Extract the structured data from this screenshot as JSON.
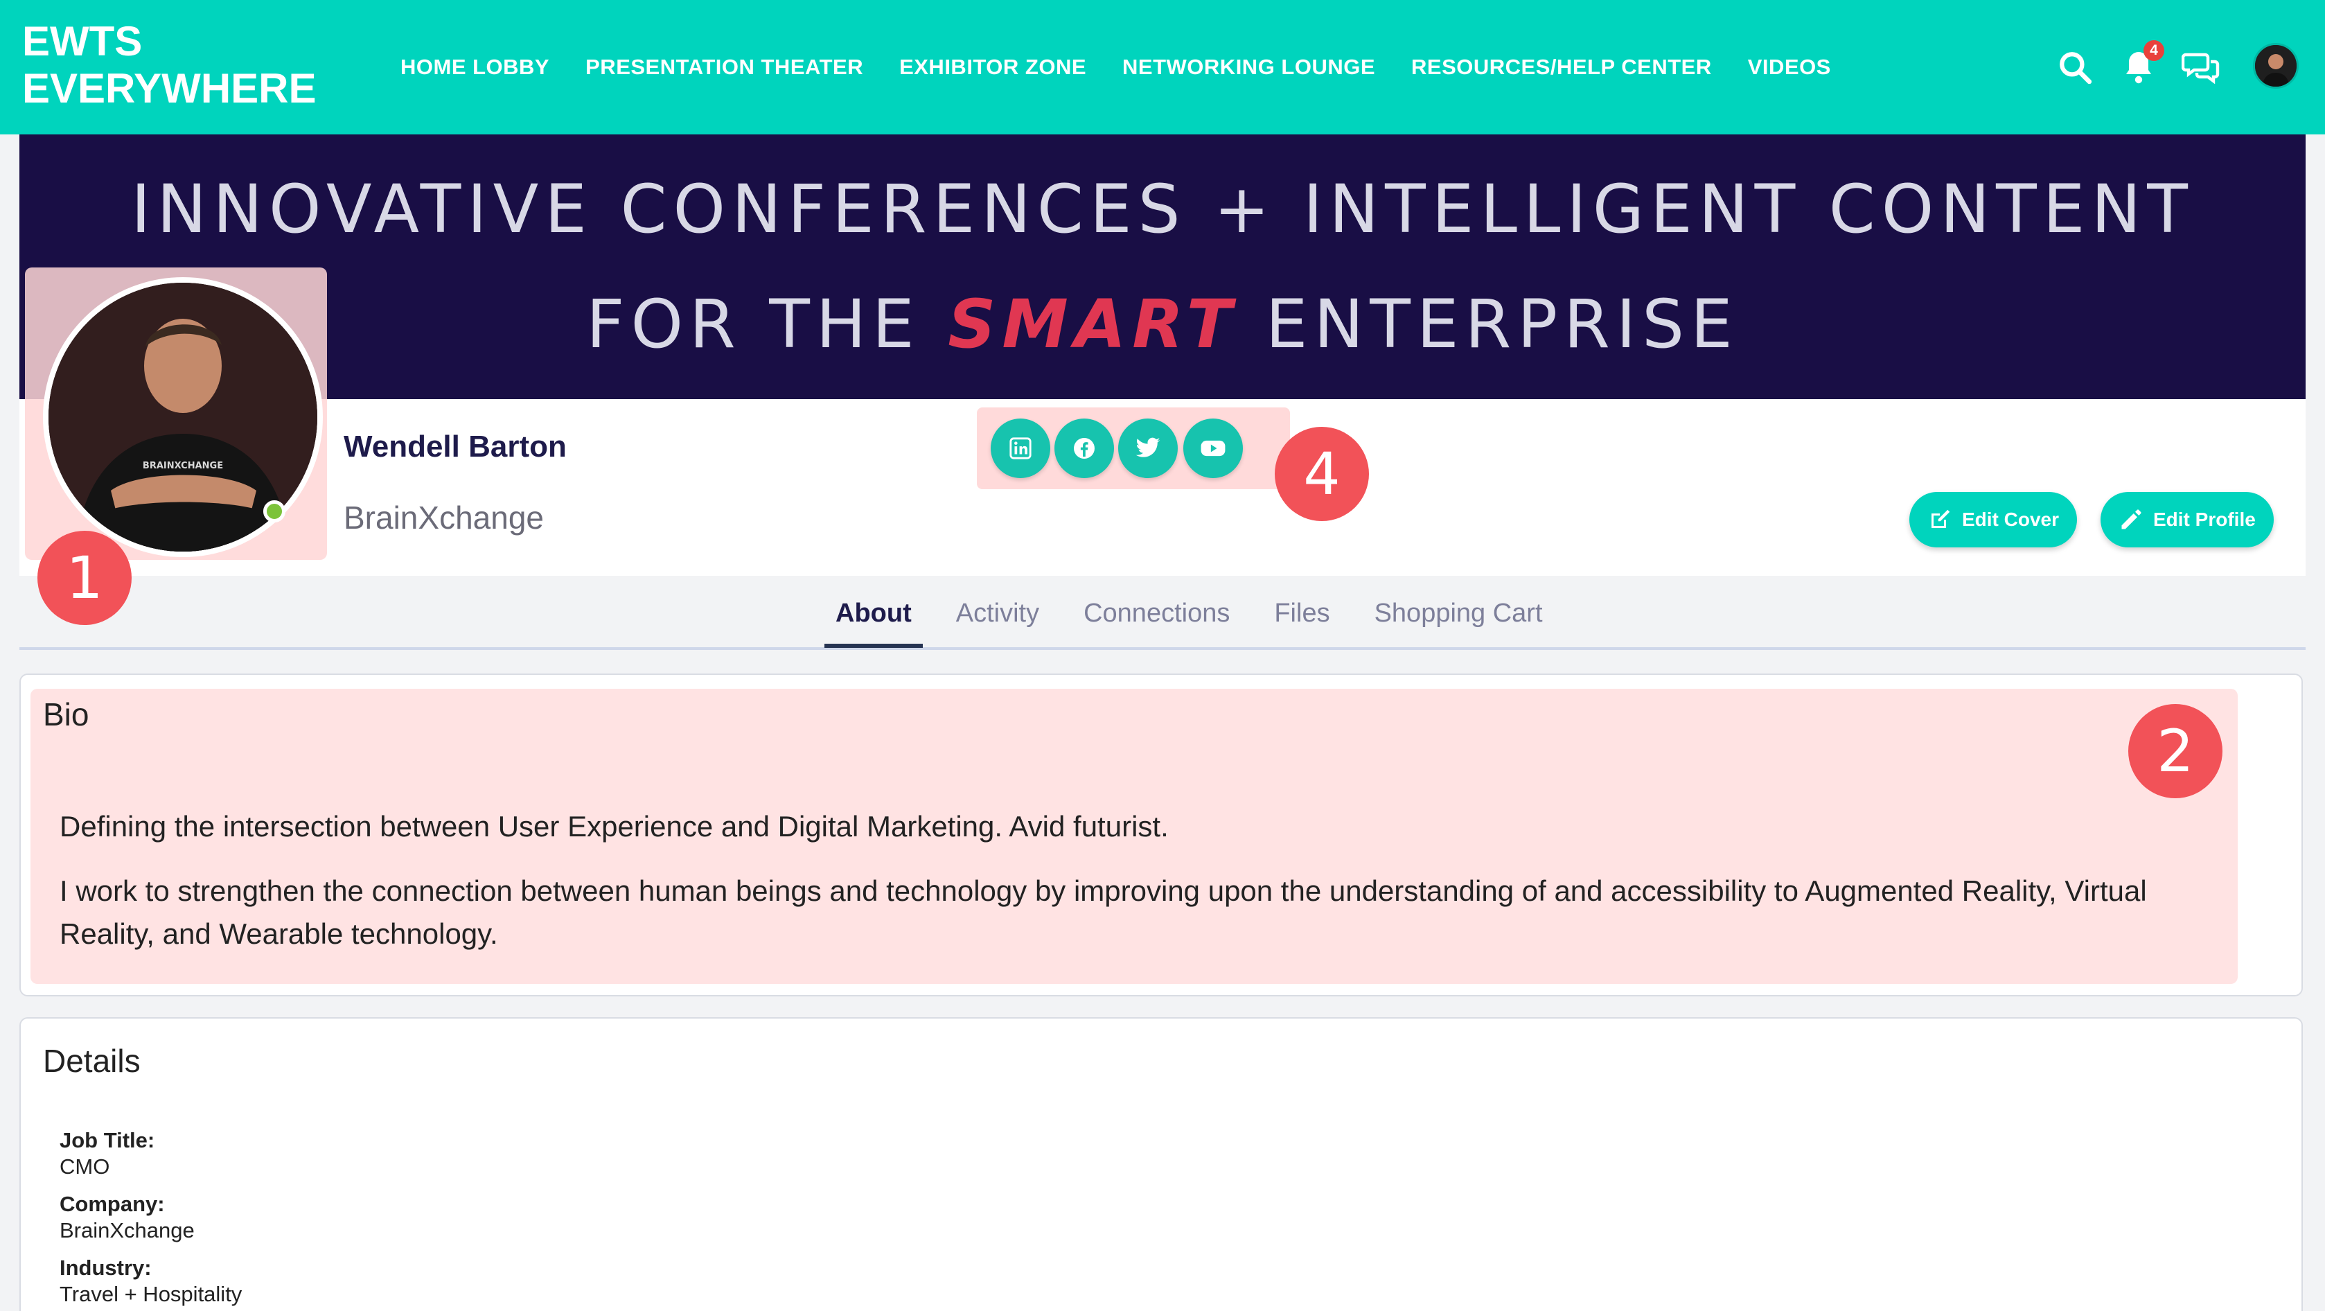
{
  "brand": {
    "line1": "EWTS",
    "line2": "EVERYWHERE"
  },
  "nav": [
    {
      "label": "HOME LOBBY"
    },
    {
      "label": "PRESENTATION THEATER"
    },
    {
      "label": "EXHIBITOR ZONE"
    },
    {
      "label": "NETWORKING LOUNGE"
    },
    {
      "label": "RESOURCES/HELP CENTER"
    },
    {
      "label": "VIDEOS"
    }
  ],
  "toolbar": {
    "notification_count": "4"
  },
  "banner": {
    "line1": "INNOVATIVE CONFERENCES + INTELLIGENT CONTENT",
    "line2_prefix": "FOR THE ",
    "line2_highlight": "SMART",
    "line2_suffix": " ENTERPRISE"
  },
  "profile": {
    "name": "Wendell Barton",
    "company": "BrainXchange",
    "shirt_text": "BRAINXCHANGE"
  },
  "buttons": {
    "edit_cover": "Edit Cover",
    "edit_profile": "Edit Profile"
  },
  "markers": {
    "m1": "1",
    "m2": "2",
    "m4": "4"
  },
  "tabs": [
    {
      "label": "About",
      "active": true
    },
    {
      "label": "Activity"
    },
    {
      "label": "Connections"
    },
    {
      "label": "Files"
    },
    {
      "label": "Shopping Cart"
    }
  ],
  "bio": {
    "title": "Bio",
    "p1": "Defining the intersection between User Experience and Digital Marketing. Avid futurist.",
    "p2": "I work to strengthen the connection between human beings and technology by improving upon the understanding of and accessibility to Augmented Reality, Virtual Reality, and Wearable technology."
  },
  "details": {
    "title": "Details",
    "items": [
      {
        "label": "Job Title:",
        "value": "CMO"
      },
      {
        "label": "Company:",
        "value": "BrainXchange"
      },
      {
        "label": "Industry:",
        "value": "Travel + Hospitality"
      }
    ]
  },
  "colors": {
    "accent": "#00d4bd",
    "banner": "#190e45",
    "highlight": "#e03752",
    "marker": "#f25258"
  }
}
